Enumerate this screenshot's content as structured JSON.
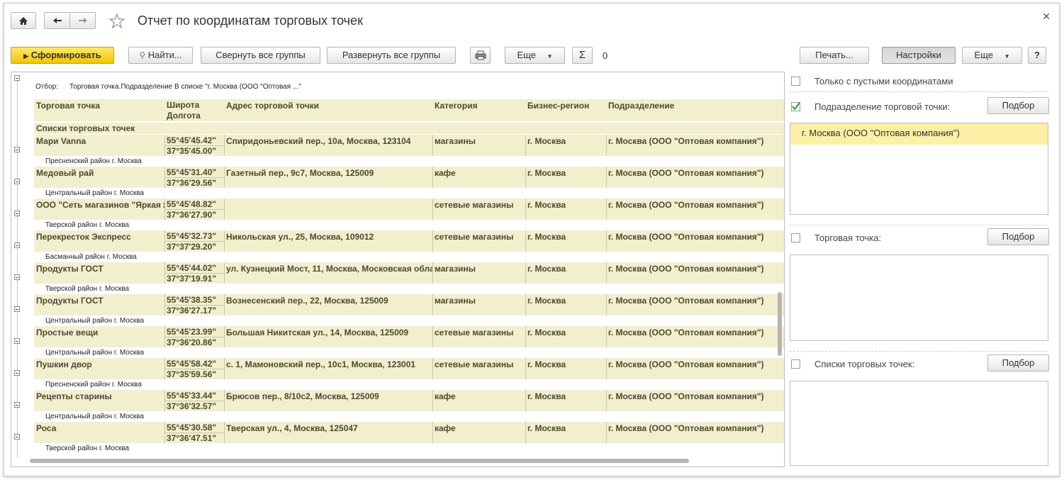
{
  "window": {
    "title": "Отчет по координатам торговых точек"
  },
  "toolbar": {
    "generate": "Сформировать",
    "find": "Найти...",
    "collapse_all": "Свернуть все группы",
    "expand_all": "Развернуть все группы",
    "more": "Еще",
    "sum_value": "0",
    "print": "Печать...",
    "settings": "Настройки",
    "more_right": "Еще",
    "help": "?"
  },
  "report": {
    "filter_label": "Отбор:",
    "filter_text": "Торговая точка.Подразделение В списке \"г. Москва  (ООО \"Оптовая ...\"",
    "columns": {
      "name": "Торговая точка",
      "lat": "Широта",
      "lon": "Долгота",
      "address": "Адрес торговой точки",
      "category": "Категория",
      "region": "Бизнес-регион",
      "division": "Подразделение"
    },
    "group_title": "Списки торговых точек",
    "rows": [
      {
        "name": "Мари Vanna",
        "lat": "55°45'45.42\"",
        "lon": "37°35'45.00\"",
        "address": "Спиридоньевский пер., 10а, Москва, 123104",
        "category": "магазины",
        "region": "г. Москва",
        "division": "г. Москва  (ООО \"Оптовая компания\")",
        "district": "Пресненский район г. Москва"
      },
      {
        "name": "Медовый рай",
        "lat": "55°45'31.40\"",
        "lon": "37°36'29.56\"",
        "address": "Газетный пер., 9с7, Москва, 125009",
        "category": "кафе",
        "region": "г. Москва",
        "division": "г. Москва  (ООО \"Оптовая компания\")",
        "district": "Центральный район г. Москва"
      },
      {
        "name": "ООО \"Сеть магазинов \"Яркая ж",
        "lat": "55°45'48.82\"",
        "lon": "37°36'27.90\"",
        "address": "",
        "category": "сетевые магазины",
        "region": "г. Москва",
        "division": "г. Москва  (ООО \"Оптовая компания\")",
        "district": "Тверской район г. Москва"
      },
      {
        "name": "Перекресток Экспресс",
        "lat": "55°45'32.73\"",
        "lon": "37°37'29.20\"",
        "address": "Никольская ул., 25, Москва, 109012",
        "category": "сетевые магазины",
        "region": "г. Москва",
        "division": "г. Москва  (ООО \"Оптовая компания\")",
        "district": "Басманный район г. Москва"
      },
      {
        "name": "Продукты ГОСТ",
        "lat": "55°45'44.02\"",
        "lon": "37°37'19.91\"",
        "address": "ул. Кузнецкий Мост, 11, Москва, Московская обла",
        "category": "магазины",
        "region": "г. Москва",
        "division": "г. Москва  (ООО \"Оптовая компания\")",
        "district": "Тверской район г. Москва"
      },
      {
        "name": "Продукты ГОСТ",
        "lat": "55°45'38.35\"",
        "lon": "37°36'27.17\"",
        "address": "Вознесенский пер., 22, Москва, 125009",
        "category": "магазины",
        "region": "г. Москва",
        "division": "г. Москва  (ООО \"Оптовая компания\")",
        "district": "Центральный район г. Москва"
      },
      {
        "name": "Простые вещи",
        "lat": "55°45'23.99\"",
        "lon": "37°36'20.86\"",
        "address": "Большая Никитская ул., 14, Москва, 125009",
        "category": "сетевые магазины",
        "region": "г. Москва",
        "division": "г. Москва  (ООО \"Оптовая компания\")",
        "district": "Центральный район г. Москва"
      },
      {
        "name": "Пушкин двор",
        "lat": "55°45'58.42\"",
        "lon": "37°35'59.56\"",
        "address": "с. 1, Мамоновский пер., 10с1, Москва, 123001",
        "category": "сетевые магазины",
        "region": "г. Москва",
        "division": "г. Москва  (ООО \"Оптовая компания\")",
        "district": "Пресненский район г. Москва"
      },
      {
        "name": "Рецепты старины",
        "lat": "55°45'33.44\"",
        "lon": "37°36'32.57\"",
        "address": "Брюсов пер., 8/10с2, Москва, 125009",
        "category": "кафе",
        "region": "г. Москва",
        "division": "г. Москва  (ООО \"Оптовая компания\")",
        "district": "Центральный район г. Москва"
      },
      {
        "name": "Роса",
        "lat": "55°45'30.58\"",
        "lon": "37°36'47.51\"",
        "address": "Тверская ул., 4, Москва, 125047",
        "category": "кафе",
        "region": "г. Москва",
        "division": "г. Москва  (ООО \"Оптовая компания\")",
        "district": "Тверской район г. Москва"
      }
    ]
  },
  "settings_panel": {
    "empty_coords": {
      "label": "Только с пустыми координатами",
      "checked": false
    },
    "division": {
      "label": "Подразделение торговой точки:",
      "checked": true,
      "pick": "Подбор",
      "items": [
        "г. Москва  (ООО \"Оптовая компания\")"
      ]
    },
    "outlet": {
      "label": "Торговая точка:",
      "checked": false,
      "pick": "Подбор"
    },
    "outlet_lists": {
      "label": "Списки торговых точек:",
      "checked": false,
      "pick": "Подбор"
    }
  },
  "icons": [
    "home-icon",
    "back-arrow-icon",
    "forward-arrow-icon",
    "star-icon",
    "close-icon",
    "search-icon",
    "print-icon",
    "sum-icon",
    "dropdown-arrow-icon",
    "checkmark-icon"
  ]
}
